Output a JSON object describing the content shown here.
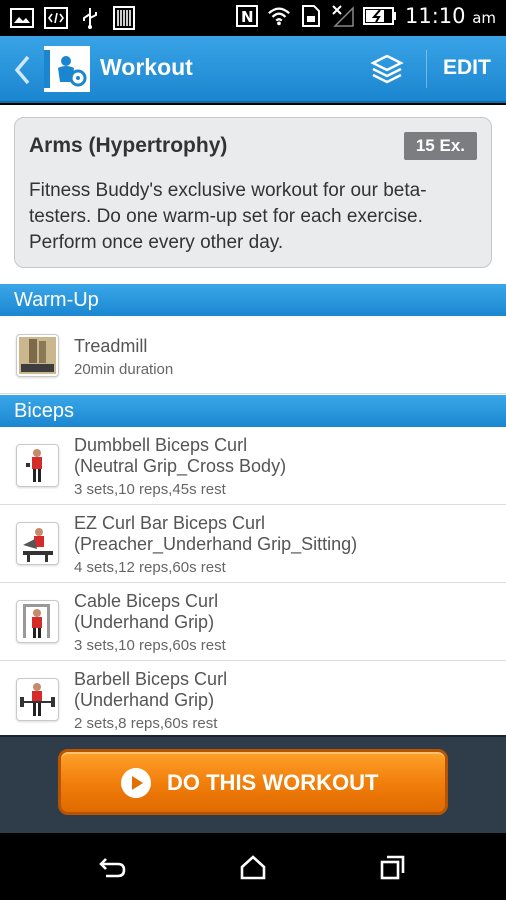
{
  "status_bar": {
    "time": "11:10",
    "ampm": "am",
    "icons": [
      "image-icon",
      "code-icon",
      "usb-icon",
      "barcode-icon",
      "nfc-icon",
      "wifi-icon",
      "sim-icon",
      "no-signal-icon",
      "battery-charging-icon"
    ]
  },
  "action_bar": {
    "title": "Workout",
    "edit_label": "EDIT"
  },
  "workout": {
    "title": "Arms (Hypertrophy)",
    "exercise_count": "15 Ex.",
    "description": "Fitness Buddy's exclusive workout for our beta-testers. Do one warm-up set for each exercise. Perform once every other day."
  },
  "sections": {
    "warmup": {
      "label": "Warm-Up",
      "items": [
        {
          "title": "Treadmill",
          "detail": "20min duration"
        }
      ]
    },
    "biceps": {
      "label": "Biceps",
      "items": [
        {
          "title_line1": "Dumbbell Biceps Curl",
          "title_line2": "(Neutral Grip_Cross Body)",
          "detail": "3 sets,10 reps,45s rest"
        },
        {
          "title_line1": "EZ Curl Bar Biceps Curl",
          "title_line2": "(Preacher_Underhand Grip_Sitting)",
          "detail": "4 sets,12 reps,60s rest"
        },
        {
          "title_line1": "Cable Biceps Curl",
          "title_line2": "(Underhand Grip)",
          "detail": "3 sets,10 reps,60s rest"
        },
        {
          "title_line1": "Barbell Biceps Curl",
          "title_line2": "(Underhand Grip)",
          "detail": "2 sets,8 reps,60s rest"
        }
      ]
    }
  },
  "cta": {
    "label": "DO THIS WORKOUT"
  },
  "colors": {
    "accent": "#1a86d0",
    "cta": "#f07c0a",
    "bottom_bar": "#2f3c4a"
  }
}
